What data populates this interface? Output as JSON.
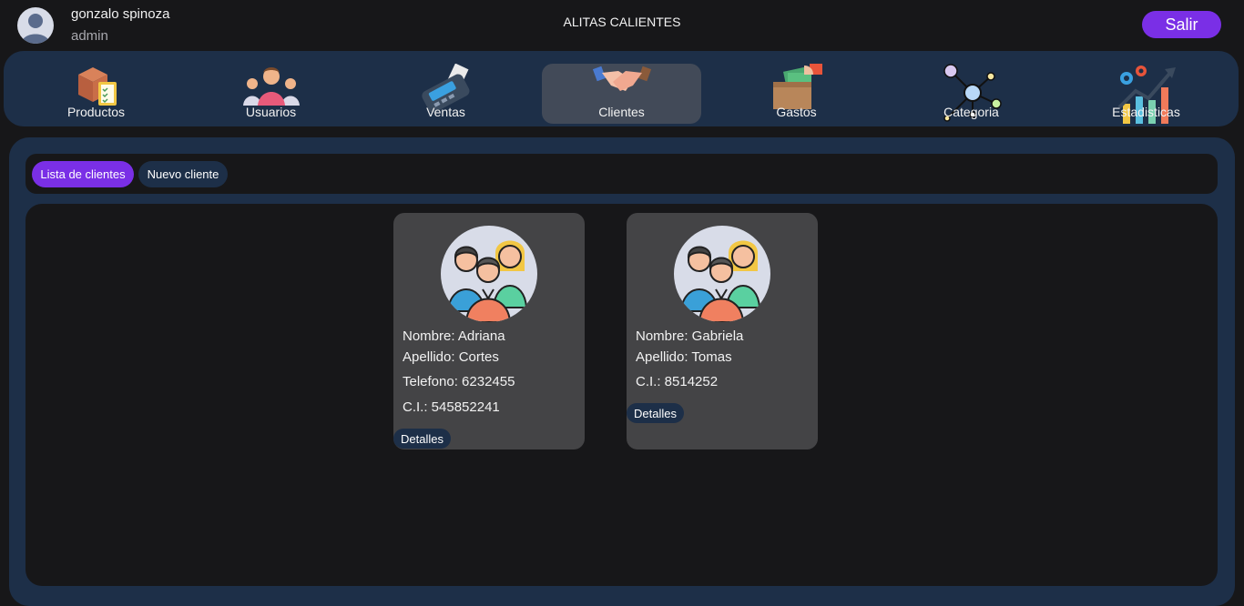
{
  "header": {
    "user_name": "gonzalo spinoza",
    "user_role": "admin",
    "app_title": "ALITAS CALIENTES",
    "logout_label": "Salir"
  },
  "nav": {
    "items": [
      {
        "label": "Productos",
        "icon": "box-clipboard-icon"
      },
      {
        "label": "Usuarios",
        "icon": "users-group-icon"
      },
      {
        "label": "Ventas",
        "icon": "card-terminal-icon"
      },
      {
        "label": "Clientes",
        "icon": "handshake-icon"
      },
      {
        "label": "Gastos",
        "icon": "wallet-money-icon"
      },
      {
        "label": "Categoria",
        "icon": "network-nodes-icon"
      },
      {
        "label": "Estadisticas",
        "icon": "stats-chart-icon"
      }
    ],
    "active": "Clientes"
  },
  "tabs": {
    "list_label": "Lista de clientes",
    "new_label": "Nuevo cliente"
  },
  "clients": [
    {
      "nombre": "Nombre: Adriana",
      "apellido": "Apellido: Cortes",
      "telefono": "Telefono: 6232455",
      "ci": "C.I.: 545852241",
      "details_label": "Detalles"
    },
    {
      "nombre": "Nombre: Gabriela",
      "apellido": "Apellido: Tomas",
      "ci": "C.I.: 8514252",
      "details_label": "Detalles"
    }
  ],
  "colors": {
    "accent": "#7a2fe6",
    "panel": "#1d2f48",
    "background": "#171719",
    "card": "#444446"
  }
}
